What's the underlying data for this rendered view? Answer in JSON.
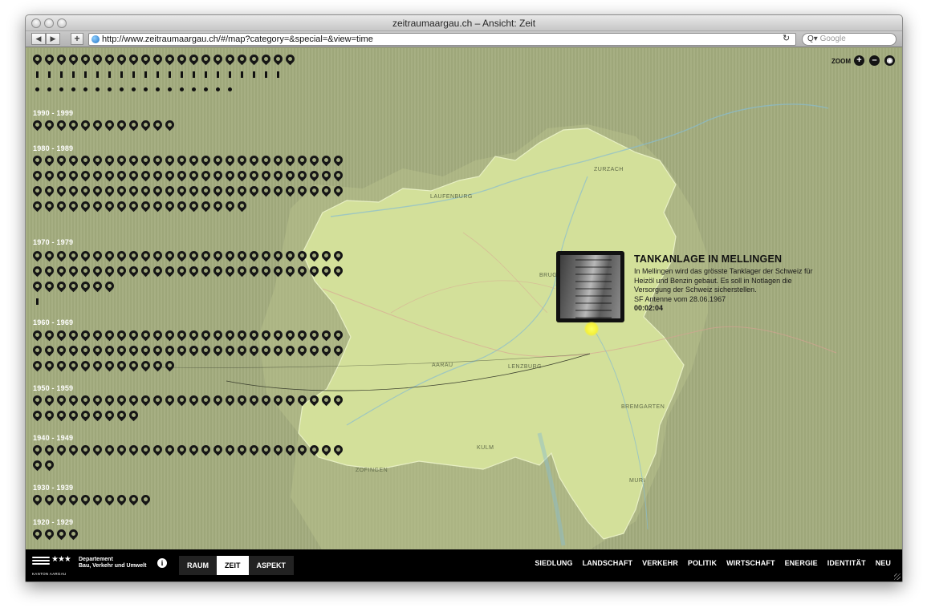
{
  "window": {
    "title": "zeitraumaargau.ch – Ansicht: Zeit",
    "url": "http://www.zeitraumaargau.ch/#/map?category=&special=&view=time",
    "search_placeholder": "Google",
    "back_icon": "back-arrow-icon",
    "forward_icon": "forward-arrow-icon"
  },
  "map": {
    "zoom_label": "ZOOM",
    "zoom_in": "+",
    "zoom_out": "–",
    "towns": [
      "ZURZACH",
      "LAUFENBURG",
      "BRUGG",
      "AARAU",
      "LENZBURG",
      "BREMGARTEN",
      "KULM",
      "ZOFINGEN",
      "MURI"
    ],
    "colors": {
      "background": "#a3ac7e",
      "region": "#d3e09a",
      "highlight": "#f4f03a",
      "pin": "#161616"
    }
  },
  "timeline": {
    "decades": [
      {
        "label": "",
        "pins": 22,
        "ticks": 21,
        "dots": 17
      },
      {
        "label": "1990 - 1999",
        "pins": 12
      },
      {
        "label": "1980 - 1989",
        "pins": 96
      },
      {
        "label": "1970 - 1979",
        "pins": 59,
        "ticks": 1
      },
      {
        "label": "1960 - 1969",
        "pins": 64
      },
      {
        "label": "1950 - 1959",
        "pins": 35
      },
      {
        "label": "1940 - 1949",
        "pins": 28
      },
      {
        "label": "1930 - 1939",
        "pins": 10
      },
      {
        "label": "1920 - 1929",
        "pins": 4
      }
    ]
  },
  "popup": {
    "title": "TANKANLAGE IN MELLINGEN",
    "body": "In Mellingen wird das grösste Tanklager der Schweiz für Heizöl und Benzin gebaut. Es soll in Notlagen die Versorgung der Schweiz sicherstellen.",
    "source": "SF Antenne vom 28.06.1967",
    "duration": "00:02:04"
  },
  "footer": {
    "logo_caption": "KANTON AARGAU",
    "department_line1": "Departement",
    "department_line2": "Bau, Verkehr und Umwelt",
    "info": "i",
    "modes": [
      {
        "label": "RAUM",
        "active": false
      },
      {
        "label": "ZEIT",
        "active": true
      },
      {
        "label": "ASPEKT",
        "active": false
      }
    ],
    "categories": [
      "SIEDLUNG",
      "LANDSCHAFT",
      "VERKEHR",
      "POLITIK",
      "WIRTSCHAFT",
      "ENERGIE",
      "IDENTITÄT",
      "NEU"
    ]
  }
}
